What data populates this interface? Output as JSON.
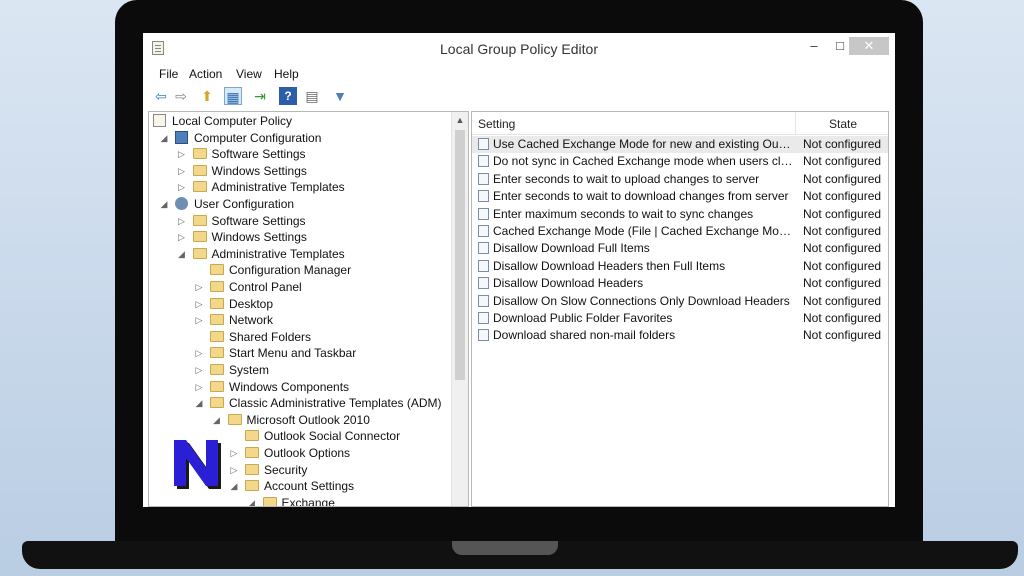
{
  "window": {
    "title": "Local Group Policy Editor",
    "minimize": "–",
    "maximize": "□",
    "close": "✕"
  },
  "menu": [
    "File",
    "Action",
    "View",
    "Help"
  ],
  "toolbar": [
    {
      "icon": "back-arrow-icon",
      "glyph": "⇦",
      "color": "#2a7fd4"
    },
    {
      "icon": "forward-arrow-icon",
      "glyph": "⇨",
      "color": "#8a8a8a"
    },
    {
      "icon": "up-folder-icon",
      "glyph": "⬆",
      "color": "#d5a62a"
    },
    {
      "icon": "show-hide-tree-icon",
      "glyph": "▦",
      "color": "#2a6bb2"
    },
    {
      "icon": "export-list-icon",
      "glyph": "⇥",
      "color": "#3a9a3a"
    },
    {
      "icon": "help-icon",
      "glyph": "?",
      "color": "#ffffff"
    },
    {
      "icon": "properties-icon",
      "glyph": "▤",
      "color": "#666666"
    },
    {
      "icon": "filter-icon",
      "glyph": "▼",
      "color": "#4a7fb8"
    }
  ],
  "tree": [
    {
      "label": "Local Computer Policy",
      "level": 0,
      "arrow": "",
      "icon": "policy"
    },
    {
      "label": "Computer Configuration",
      "level": 1,
      "arrow": "◢",
      "icon": "computer"
    },
    {
      "label": "Software Settings",
      "level": 2,
      "arrow": "▷",
      "icon": "folder"
    },
    {
      "label": "Windows Settings",
      "level": 2,
      "arrow": "▷",
      "icon": "folder"
    },
    {
      "label": "Administrative Templates",
      "level": 2,
      "arrow": "▷",
      "icon": "folder"
    },
    {
      "label": "User Configuration",
      "level": 1,
      "arrow": "◢",
      "icon": "user"
    },
    {
      "label": "Software Settings",
      "level": 2,
      "arrow": "▷",
      "icon": "folder"
    },
    {
      "label": "Windows Settings",
      "level": 2,
      "arrow": "▷",
      "icon": "folder"
    },
    {
      "label": "Administrative Templates",
      "level": 2,
      "arrow": "◢",
      "icon": "folder"
    },
    {
      "label": "Configuration Manager",
      "level": 3,
      "arrow": "",
      "icon": "folder"
    },
    {
      "label": "Control Panel",
      "level": 3,
      "arrow": "▷",
      "icon": "folder"
    },
    {
      "label": "Desktop",
      "level": 3,
      "arrow": "▷",
      "icon": "folder"
    },
    {
      "label": "Network",
      "level": 3,
      "arrow": "▷",
      "icon": "folder"
    },
    {
      "label": "Shared Folders",
      "level": 3,
      "arrow": "",
      "icon": "folder"
    },
    {
      "label": "Start Menu and Taskbar",
      "level": 3,
      "arrow": "▷",
      "icon": "folder"
    },
    {
      "label": "System",
      "level": 3,
      "arrow": "▷",
      "icon": "folder"
    },
    {
      "label": "Windows Components",
      "level": 3,
      "arrow": "▷",
      "icon": "folder"
    },
    {
      "label": "Classic Administrative Templates (ADM)",
      "level": 3,
      "arrow": "◢",
      "icon": "folder"
    },
    {
      "label": "Microsoft Outlook 2010",
      "level": 4,
      "arrow": "◢",
      "icon": "folder"
    },
    {
      "label": "Outlook Social Connector",
      "level": 5,
      "arrow": "",
      "icon": "folder"
    },
    {
      "label": "Outlook Options",
      "level": 5,
      "arrow": "▷",
      "icon": "folder"
    },
    {
      "label": "Security",
      "level": 5,
      "arrow": "▷",
      "icon": "folder"
    },
    {
      "label": "Account Settings",
      "level": 5,
      "arrow": "◢",
      "icon": "folder"
    },
    {
      "label": "Exchange",
      "level": 6,
      "arrow": "◢",
      "icon": "folder"
    }
  ],
  "list": {
    "columns": {
      "setting": "Setting",
      "state": "State"
    },
    "rows": [
      {
        "setting": "Use Cached Exchange Mode for new and existing Outlook p...",
        "state": "Not configured",
        "selected": true
      },
      {
        "setting": "Do not sync in Cached Exchange mode when users click Sen...",
        "state": "Not configured"
      },
      {
        "setting": "Enter seconds to wait to upload changes to server",
        "state": "Not configured"
      },
      {
        "setting": "Enter seconds to wait to download changes from server",
        "state": "Not configured"
      },
      {
        "setting": "Enter maximum seconds to wait to sync changes",
        "state": "Not configured"
      },
      {
        "setting": "Cached Exchange Mode (File | Cached Exchange Mode)",
        "state": "Not configured"
      },
      {
        "setting": "Disallow Download Full Items",
        "state": "Not configured"
      },
      {
        "setting": "Disallow Download Headers then Full Items",
        "state": "Not configured"
      },
      {
        "setting": "Disallow Download Headers",
        "state": "Not configured"
      },
      {
        "setting": "Disallow On Slow Connections Only Download Headers",
        "state": "Not configured"
      },
      {
        "setting": "Download Public Folder Favorites",
        "state": "Not configured"
      },
      {
        "setting": "Download shared non-mail folders",
        "state": "Not configured"
      }
    ]
  },
  "logo": {
    "icon": "brand-n-logo-icon",
    "fill": "#2b1fd6",
    "shadow": "#1a1a1a"
  }
}
